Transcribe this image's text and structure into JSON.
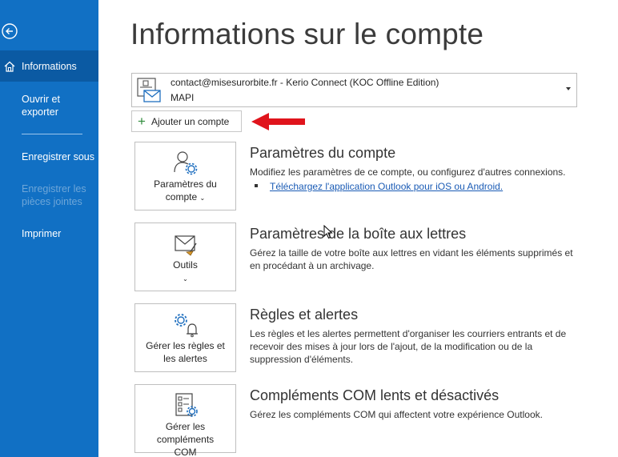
{
  "colors": {
    "sidebar": "#1170c4",
    "sidebar_selected": "#0b5aa3",
    "link": "#1a5bb5",
    "arrow": "#e0141c",
    "plus": "#2e8b3a"
  },
  "sidebar": {
    "back_icon": "back-arrow-icon",
    "items": [
      {
        "label": "Informations",
        "icon": "home-icon",
        "selected": true
      },
      {
        "label": "Ouvrir et exporter"
      },
      {
        "label": "Enregistrer sous"
      },
      {
        "label": "Enregistrer les pièces jointes",
        "disabled": true
      },
      {
        "label": "Imprimer"
      }
    ]
  },
  "main": {
    "title": "Informations sur le compte",
    "account": {
      "line1": "contact@misesurorbite.fr - Kerio Connect (KOC Offline Edition)",
      "line2": "MAPI"
    },
    "add_account_label": "Ajouter un compte",
    "sections": [
      {
        "card_label": "Paramètres du compte",
        "title": "Paramètres du compte",
        "description": "Modifiez les paramètres de ce compte, ou configurez d'autres connexions.",
        "link": "Téléchargez l'application Outlook pour iOS ou Android."
      },
      {
        "card_label": "Outils",
        "title": "Paramètres de la boîte aux lettres",
        "description": "Gérez la taille de votre boîte aux lettres en vidant les éléments supprimés et en procédant à un archivage."
      },
      {
        "card_label": "Gérer les règles et les alertes",
        "title": "Règles et alertes",
        "description": "Les règles et les alertes permettent d'organiser les courriers entrants et de recevoir des mises à jour lors de l'ajout, de la modification ou de la suppression d'éléments."
      },
      {
        "card_label": "Gérer les compléments COM",
        "title": "Compléments COM lents et désactivés",
        "description": "Gérez les compléments COM qui affectent votre expérience Outlook."
      }
    ]
  }
}
